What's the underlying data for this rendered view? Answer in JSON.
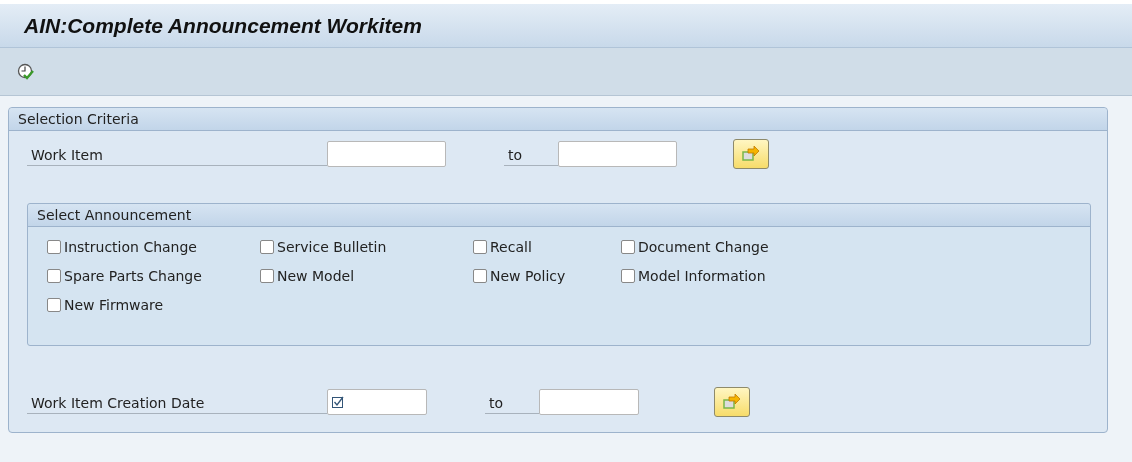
{
  "window": {
    "title": "AIN:Complete Announcement Workitem"
  },
  "selection_criteria": {
    "title": "Selection Criteria",
    "work_item": {
      "label": "Work Item",
      "to_label": "to"
    },
    "select_announcement": {
      "title": "Select Announcement",
      "options": [
        {
          "label": "Instruction Change",
          "checked": false
        },
        {
          "label": "Service Bulletin",
          "checked": false
        },
        {
          "label": "Recall",
          "checked": false
        },
        {
          "label": "Document Change",
          "checked": false
        },
        {
          "label": "Spare Parts Change",
          "checked": false
        },
        {
          "label": "New Model",
          "checked": false
        },
        {
          "label": "New Policy",
          "checked": false
        },
        {
          "label": "Model Information",
          "checked": false
        },
        {
          "label": "New Firmware",
          "checked": false
        }
      ]
    },
    "creation_date": {
      "label": "Work Item Creation Date",
      "to_label": "to",
      "required": true
    }
  }
}
